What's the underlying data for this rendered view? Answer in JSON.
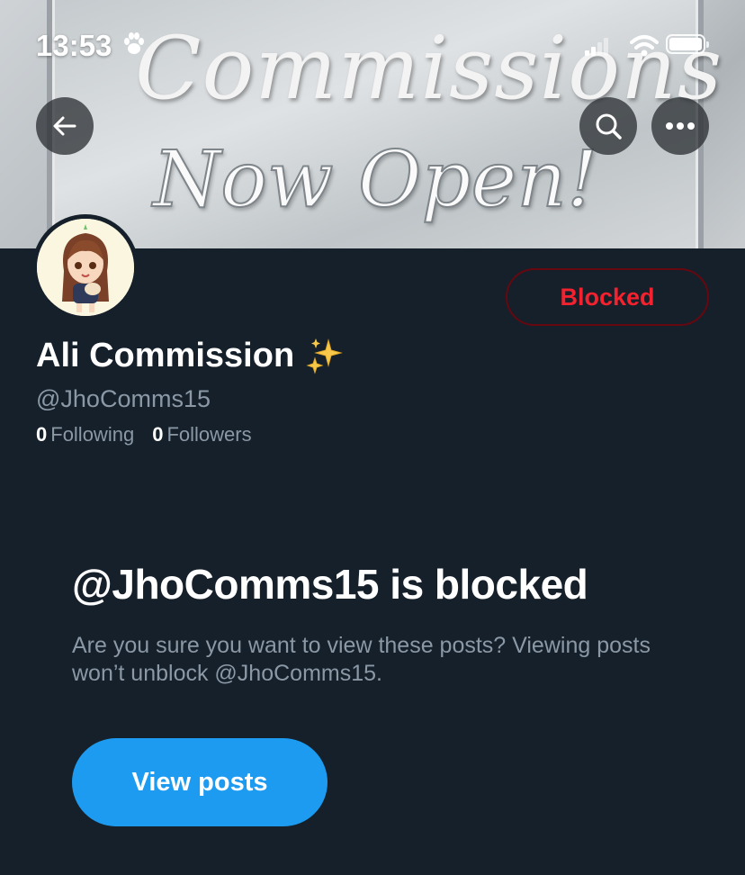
{
  "status_bar": {
    "time": "13:53",
    "icons": [
      "paw-icon",
      "cellular-signal-icon",
      "wifi-icon",
      "battery-icon"
    ]
  },
  "header": {
    "banner": {
      "line1": "Commissions",
      "line2": "Now Open!"
    },
    "back_icon": "arrow-left-icon",
    "search_icon": "search-icon",
    "more_icon": "more-horizontal-icon"
  },
  "profile": {
    "display_name": "Ali Commission",
    "name_emoji": "sparkles-icon",
    "handle": "@JhoComms15",
    "following_count": "0",
    "following_label": "Following",
    "followers_count": "0",
    "followers_label": "Followers",
    "blocked_button_label": "Blocked"
  },
  "blocked_notice": {
    "title": "@JhoComms15 is blocked",
    "description": "Are you sure you want to view these posts? Viewing posts won’t unblock @JhoComms15.",
    "view_posts_label": "View posts"
  },
  "colors": {
    "background": "#15202b",
    "accent": "#1d9bf0",
    "blocked_red": "#f4212e",
    "secondary_text": "#8b98a5"
  }
}
